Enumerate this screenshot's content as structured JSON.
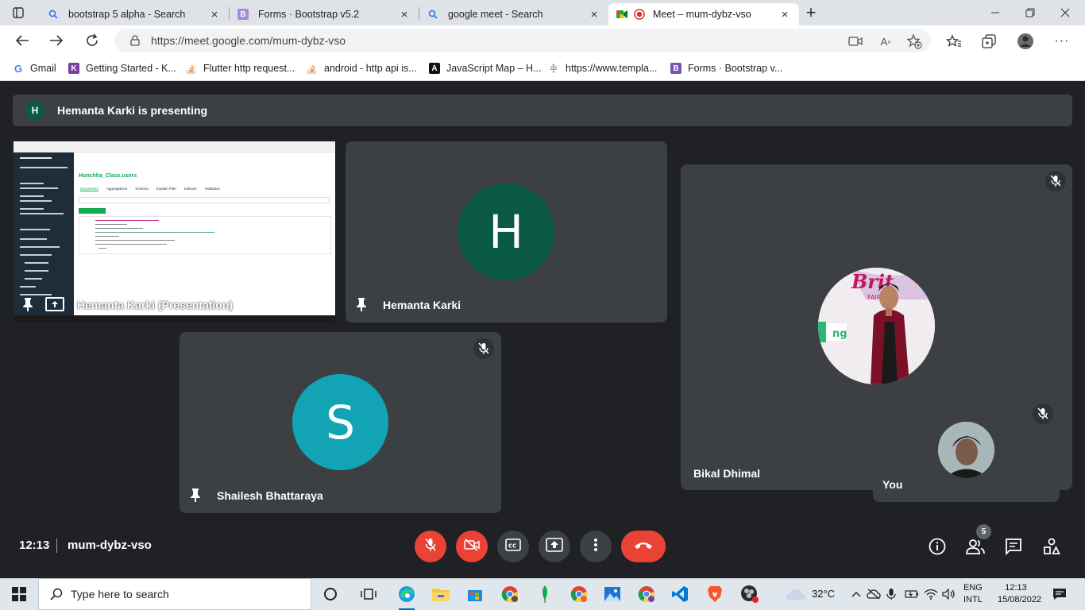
{
  "browser": {
    "tabs": [
      {
        "title": "bootstrap 5 alpha - Search",
        "icon": "search-icon",
        "active": false
      },
      {
        "title": "Forms · Bootstrap v5.2",
        "icon": "bootstrap-icon",
        "active": false
      },
      {
        "title": "google meet - Search",
        "icon": "search-icon",
        "active": false
      },
      {
        "title": "Meet – mum-dybz-vso",
        "icon": "google-meet-icon",
        "active": true
      }
    ],
    "url": "https://meet.google.com/mum-dybz-vso",
    "bookmarks": [
      {
        "label": "Gmail",
        "icon": "google-icon"
      },
      {
        "label": "Getting Started - K...",
        "icon": "k-icon"
      },
      {
        "label": "Flutter http request...",
        "icon": "stackoverflow-icon"
      },
      {
        "label": "android - http api is...",
        "icon": "stackoverflow-icon"
      },
      {
        "label": "JavaScript Map – H...",
        "icon": "a-icon"
      },
      {
        "label": "https://www.templa...",
        "icon": "template-icon"
      },
      {
        "label": "Forms · Bootstrap v...",
        "icon": "bootstrap-icon"
      }
    ]
  },
  "meet": {
    "presenting_banner": "Hemanta Karki is presenting",
    "presenter_initial": "H",
    "tiles": {
      "presentation": {
        "name": "Hemanta Karki (Presentation)"
      },
      "hemanta": {
        "name": "Hemanta Karki",
        "initial": "H"
      },
      "shailesh": {
        "name": "Shailesh Bhattaraya",
        "initial": "S"
      },
      "bikal": {
        "name": "Bikal Dhimal"
      },
      "you": {
        "name": "You"
      }
    },
    "presentation_screen": {
      "collection": "Hunchha_Class.users",
      "tabs": [
        "Documents",
        "Aggregations",
        "Schema",
        "Explain Plan",
        "Indexes",
        "Validation"
      ]
    },
    "clock": "12:13",
    "meeting_code": "mum-dybz-vso",
    "participants_count": "5",
    "colors": {
      "end_call": "#ea4335",
      "hemanta_avatar": "#0b5b44",
      "shailesh_avatar": "#12a4b4"
    }
  },
  "taskbar": {
    "search_placeholder": "Type here to search",
    "temperature": "32°C",
    "lang_line1": "ENG",
    "lang_line2": "INTL",
    "time": "12:13",
    "date": "15/08/2022"
  }
}
